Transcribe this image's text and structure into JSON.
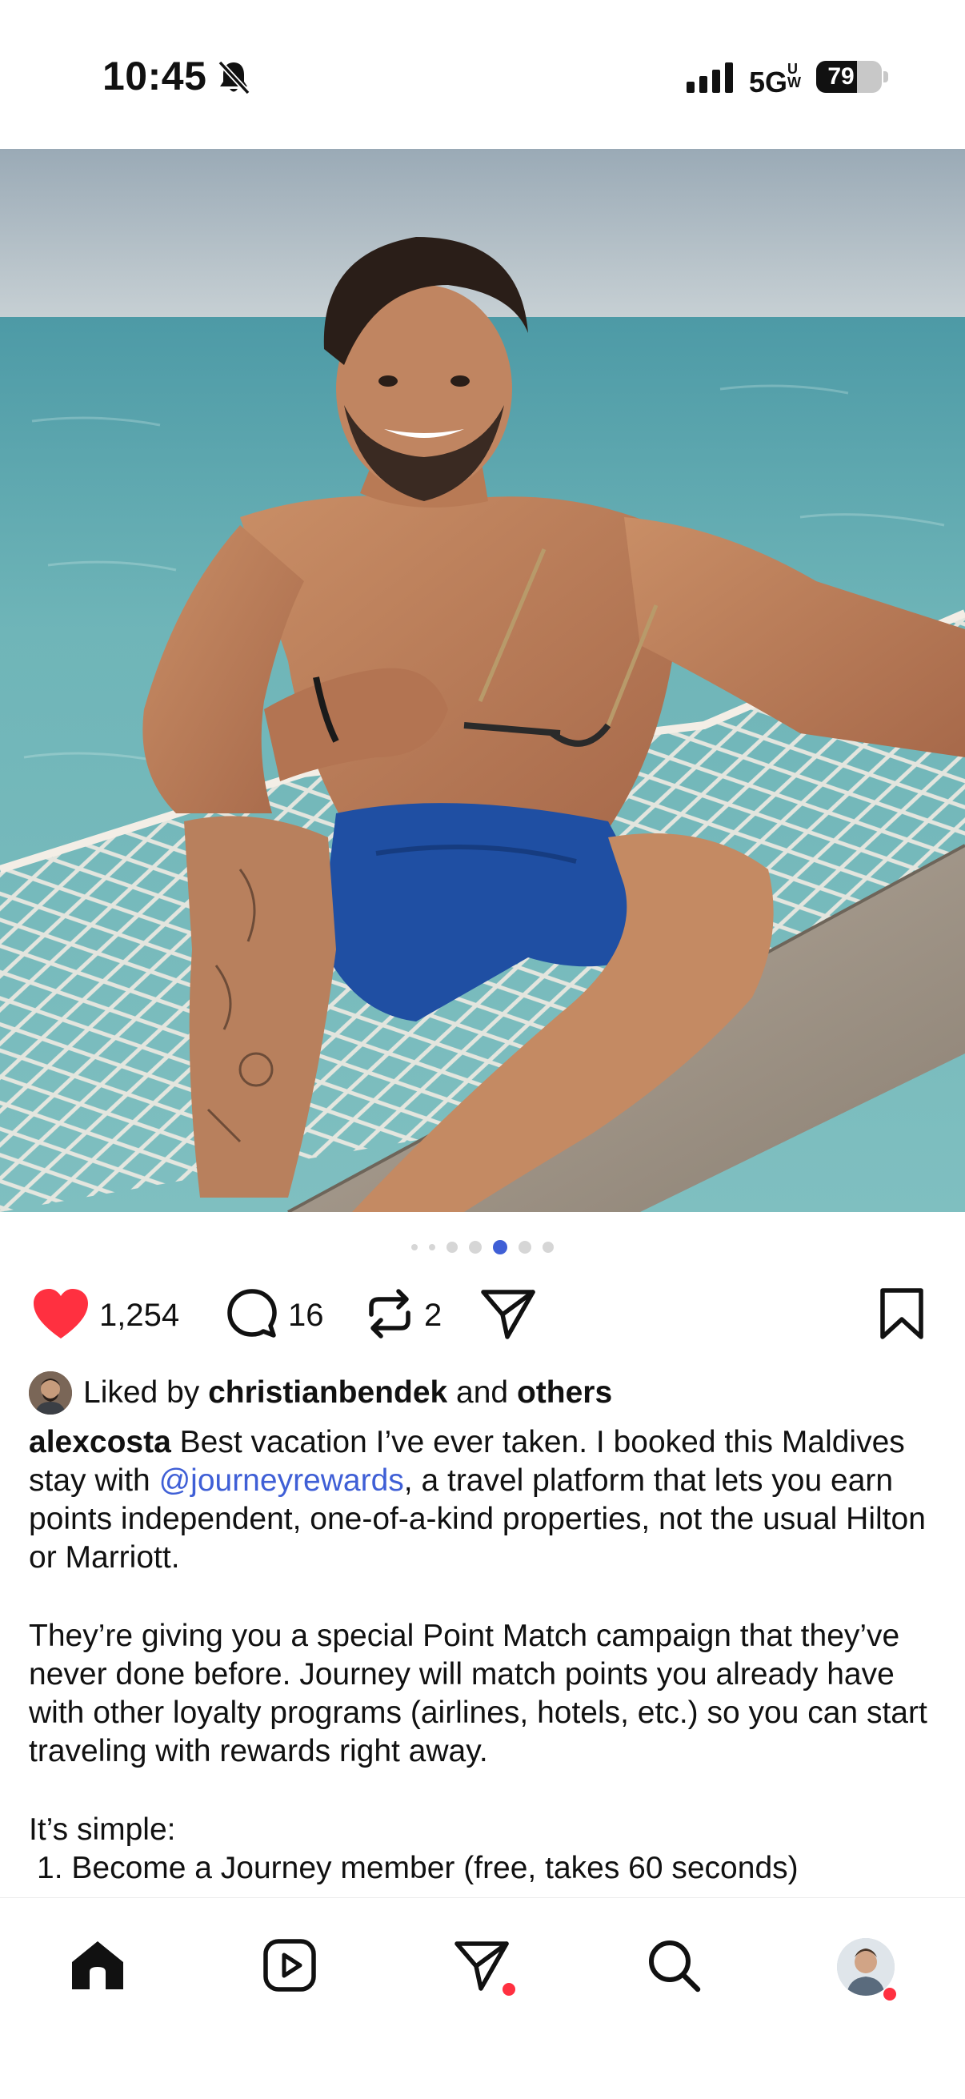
{
  "status_bar": {
    "time": "10:45",
    "network": "5G",
    "network_sub": "UW",
    "battery_percent": 79,
    "battery_label": "79"
  },
  "post": {
    "carousel": {
      "count": 7,
      "active_index": 4
    },
    "likes_count": "1,254",
    "comments_count": "16",
    "reposts_count": "2",
    "liked_by_prefix": "Liked by",
    "liked_by_user": "christianbendek",
    "liked_by_and": "and",
    "liked_by_others": "others",
    "caption": {
      "username": "alexcosta",
      "text_1": "Best vacation I’ve ever taken. I booked this Maldives stay with",
      "mention": "@journeyrewards",
      "text_2": ", a travel platform that lets you earn points independent, one-of-a-kind properties, not the usual Hilton or Marriott.",
      "paragraph_2": "They’re giving you a special Point Match campaign that they’ve never done before. Journey will match points you already have with other loyalty programs (airlines, hotels, etc.) so you can start traveling with rewards right away.",
      "paragraph_3": "It’s simple:",
      "list": [
        "1. Become a Journey member (free, takes 60 seconds)"
      ]
    }
  },
  "colors": {
    "like_red": "#ff3040",
    "mention_blue": "#3f5fd6",
    "active_dot": "#3f5fd6",
    "notification_dot": "#ff3040"
  },
  "tabbar": {
    "items": [
      {
        "icon": "home-icon"
      },
      {
        "icon": "reels-icon"
      },
      {
        "icon": "messages-icon"
      },
      {
        "icon": "search-icon"
      },
      {
        "icon": "profile-avatar"
      }
    ]
  }
}
